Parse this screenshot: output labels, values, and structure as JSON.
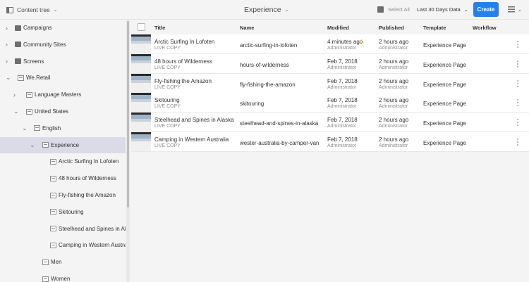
{
  "topbar": {
    "rail_label": "Content tree",
    "title": "Experience",
    "select_all": "Select All",
    "filter": "Last 30 Days Data",
    "create": "Create"
  },
  "colors": {
    "accent": "#2680eb",
    "selected": "#dadbe6",
    "warning": "#e8c34a"
  },
  "tree": [
    {
      "label": "Campaigns",
      "level": 0,
      "icon": "folder",
      "chevron": "right"
    },
    {
      "label": "Community Sites",
      "level": 0,
      "icon": "folder",
      "chevron": "right"
    },
    {
      "label": "Screens",
      "level": 0,
      "icon": "folder",
      "chevron": "right"
    },
    {
      "label": "We.Retail",
      "level": 0,
      "icon": "page",
      "chevron": "down"
    },
    {
      "label": "Language Masters",
      "level": 1,
      "icon": "page",
      "chevron": "right"
    },
    {
      "label": "United States",
      "level": 1,
      "icon": "page",
      "chevron": "down"
    },
    {
      "label": "English",
      "level": 2,
      "icon": "page",
      "chevron": "down"
    },
    {
      "label": "Experience",
      "level": 3,
      "icon": "page",
      "chevron": "down",
      "selected": true
    },
    {
      "label": "Arctic Surfing In Lofoten",
      "level": 4,
      "icon": "page"
    },
    {
      "label": "48 hours of Wilderness",
      "level": 4,
      "icon": "page"
    },
    {
      "label": "Fly-fishing the Amazon",
      "level": 4,
      "icon": "page"
    },
    {
      "label": "Skitouring",
      "level": 4,
      "icon": "page"
    },
    {
      "label": "Steelhead and Spines in Alaska",
      "level": 4,
      "icon": "page"
    },
    {
      "label": "Camping in Western Australia",
      "level": 4,
      "icon": "page"
    },
    {
      "label": "Men",
      "level": 3,
      "icon": "page"
    },
    {
      "label": "Women",
      "level": 3,
      "icon": "page"
    }
  ],
  "table": {
    "headers": {
      "title": "Title",
      "name": "Name",
      "modified": "Modified",
      "published": "Published",
      "template": "Template",
      "workflow": "Workflow"
    },
    "rows": [
      {
        "title": "Arctic Surfing In Lofoten",
        "status": "LIVE COPY",
        "name": "arctic-surfing-in-lofoten",
        "modified": "4 minutes ago",
        "modified_by": "Administrator",
        "warning": true,
        "published": "2 hours ago",
        "published_by": "Administrator",
        "template": "Experience Page"
      },
      {
        "title": "48 hours of Wilderness",
        "status": "LIVE COPY",
        "name": "hours-of-wilderness",
        "modified": "Feb 7, 2018",
        "modified_by": "Administrator",
        "published": "2 hours ago",
        "published_by": "Administrator",
        "template": "Experience Page"
      },
      {
        "title": "Fly-fishing the Amazon",
        "status": "LIVE COPY",
        "name": "fly-fishing-the-amazon",
        "modified": "Feb 7, 2018",
        "modified_by": "Administrator",
        "published": "2 hours ago",
        "published_by": "Administrator",
        "template": "Experience Page"
      },
      {
        "title": "Skitouring",
        "status": "LIVE COPY",
        "name": "skitouring",
        "modified": "Feb 7, 2018",
        "modified_by": "Administrator",
        "published": "2 hours ago",
        "published_by": "Administrator",
        "template": "Experience Page"
      },
      {
        "title": "Steelhead and Spines in Alaska",
        "status": "LIVE COPY",
        "name": "steelhead-and-spines-in-alaska",
        "modified": "Feb 7, 2018",
        "modified_by": "Administrator",
        "published": "2 hours ago",
        "published_by": "Administrator",
        "template": "Experience Page"
      },
      {
        "title": "Camping in Western Australia",
        "status": "LIVE COPY",
        "name": "wester-australia-by-camper-van",
        "modified": "Feb 7, 2018",
        "modified_by": "Administrator",
        "published": "2 hours ago",
        "published_by": "Administrator",
        "template": "Experience Page"
      }
    ]
  }
}
